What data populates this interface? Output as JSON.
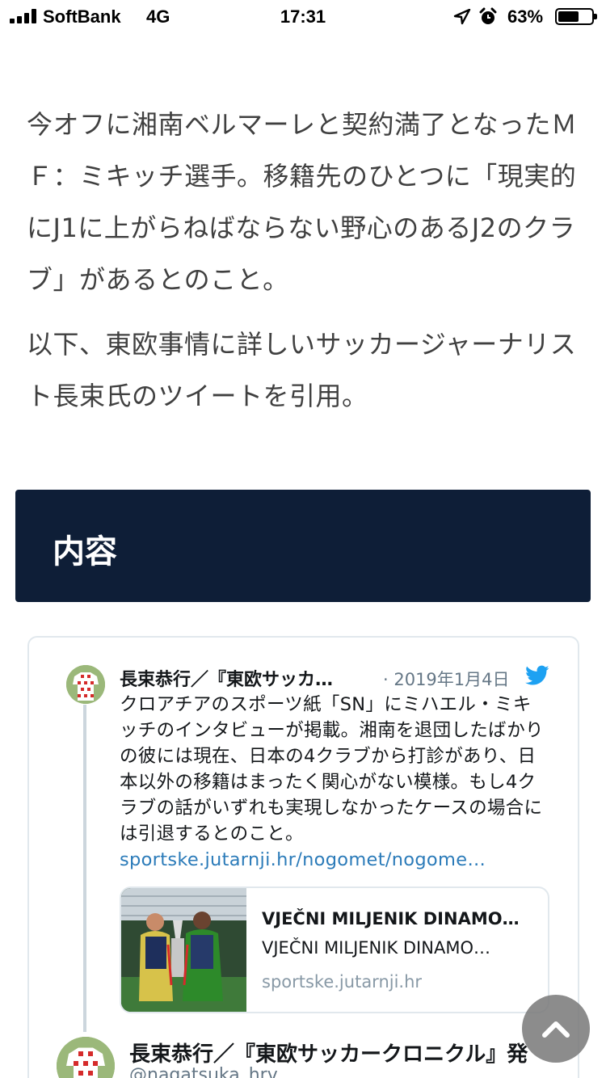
{
  "status_bar": {
    "carrier": "SoftBank",
    "network": "4G",
    "time": "17:31",
    "battery_percent": "63%",
    "battery_level": 0.63,
    "icons": [
      "signal-icon",
      "location-arrow-icon",
      "alarm-clock-icon",
      "battery-icon"
    ]
  },
  "article": {
    "paragraphs": [
      "今オフに湘南ベルマーレと契約満了となったＭＦ：ミキッチ選手。移籍先のひとつに「現実的にJ1に上がらねばならない野心のあるJ2のクラブ」があるとのこと。",
      "以下、東欧事情に詳しいサッカージャーナリスト長束氏のツイートを引用。"
    ]
  },
  "section_heading": "内容",
  "tweet": {
    "author_name": "長束恭行／『東欧サッカ…",
    "date": "· 2019年1月4日",
    "text": "クロアチアのスポーツ紙「SN」にミハエル・ミキッチのインタビューが掲載。湘南を退団したばかりの彼には現在、日本の4クラブから打診があり、日本以外の移籍はまったく関心がない模様。もし4クラブの話がいずれも実現しなかったケースの場合には引退するとのこと。",
    "link_text": "sportske.jutarnji.hr/nogomet/nogome…",
    "card": {
      "title": "VJEČNI MILJENIK DINAMO…",
      "description": "VJEČNI MILJENIK DINAMO…",
      "domain": "sportske.jutarnji.hr"
    }
  },
  "next_tweet": {
    "author_name": "長束恭行／『東欧サッカークロニクル』発",
    "handle": "@nagatsuka_hrv"
  },
  "colors": {
    "heading_bg": "#0e1e37",
    "link": "#2b7bb9",
    "twitter_blue": "#1da1f2"
  }
}
